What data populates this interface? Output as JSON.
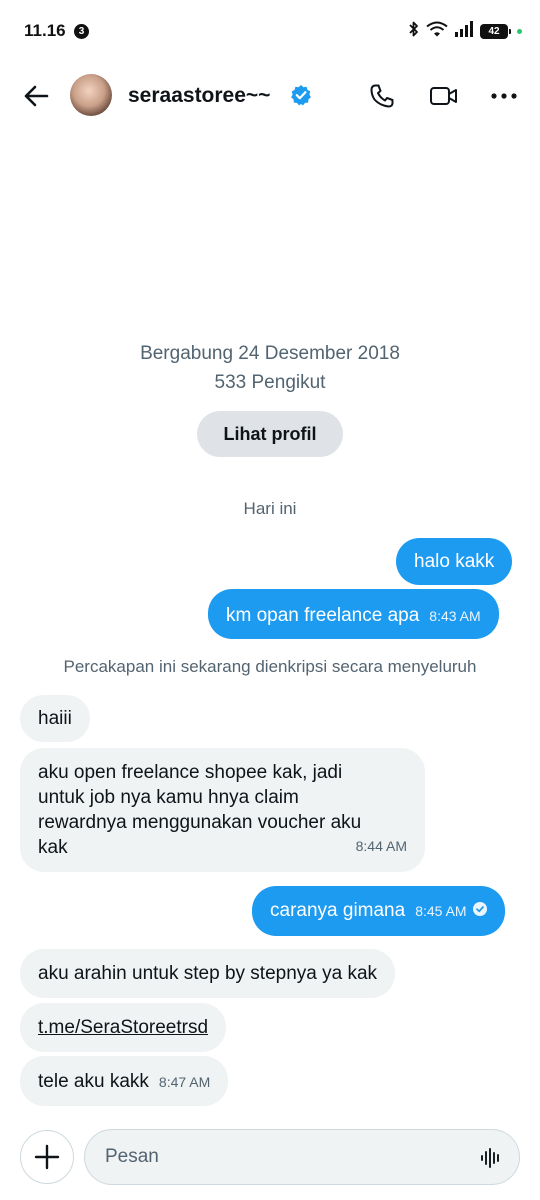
{
  "status_bar": {
    "time": "11.16",
    "notification_count": "3",
    "battery": "42"
  },
  "header": {
    "contact_name": "seraastoree~~",
    "icons": [
      "back-arrow-icon",
      "verified-badge-icon",
      "phone-icon",
      "video-camera-icon",
      "more-options-icon"
    ]
  },
  "profile": {
    "joined": "Bergabung 24 Desember 2018",
    "followers": "533 Pengikut",
    "view_profile_label": "Lihat profil"
  },
  "day_separator": "Hari ini",
  "encryption_note": "Percakapan ini sekarang dienkripsi secara menyeluruh",
  "messages": [
    {
      "direction": "sent",
      "text": "halo kakk",
      "time": ""
    },
    {
      "direction": "sent",
      "text": "km opan freelance apa",
      "time": "8:43 AM"
    },
    {
      "direction": "received",
      "text": "haiii",
      "time": ""
    },
    {
      "direction": "received",
      "text": "aku open freelance shopee kak, jadi\nuntuk job nya kamu hnya claim\nrewardnya menggunakan voucher aku\nkak",
      "time": "8:44 AM"
    },
    {
      "direction": "sent",
      "text": "caranya gimana",
      "time": "8:45 AM",
      "read": true
    },
    {
      "direction": "received",
      "text": "aku arahin untuk step by stepnya ya kak",
      "time": ""
    },
    {
      "direction": "received",
      "text": "t.me/SeraStoreetrsd",
      "time": "",
      "is_link": true
    },
    {
      "direction": "received",
      "text": "tele aku kakk",
      "time": "8:47 AM"
    }
  ],
  "composer": {
    "placeholder": "Pesan",
    "value": ""
  },
  "colors": {
    "accent": "#1d9bf0",
    "received_bubble": "#eff3f4",
    "secondary_text": "#536471"
  }
}
